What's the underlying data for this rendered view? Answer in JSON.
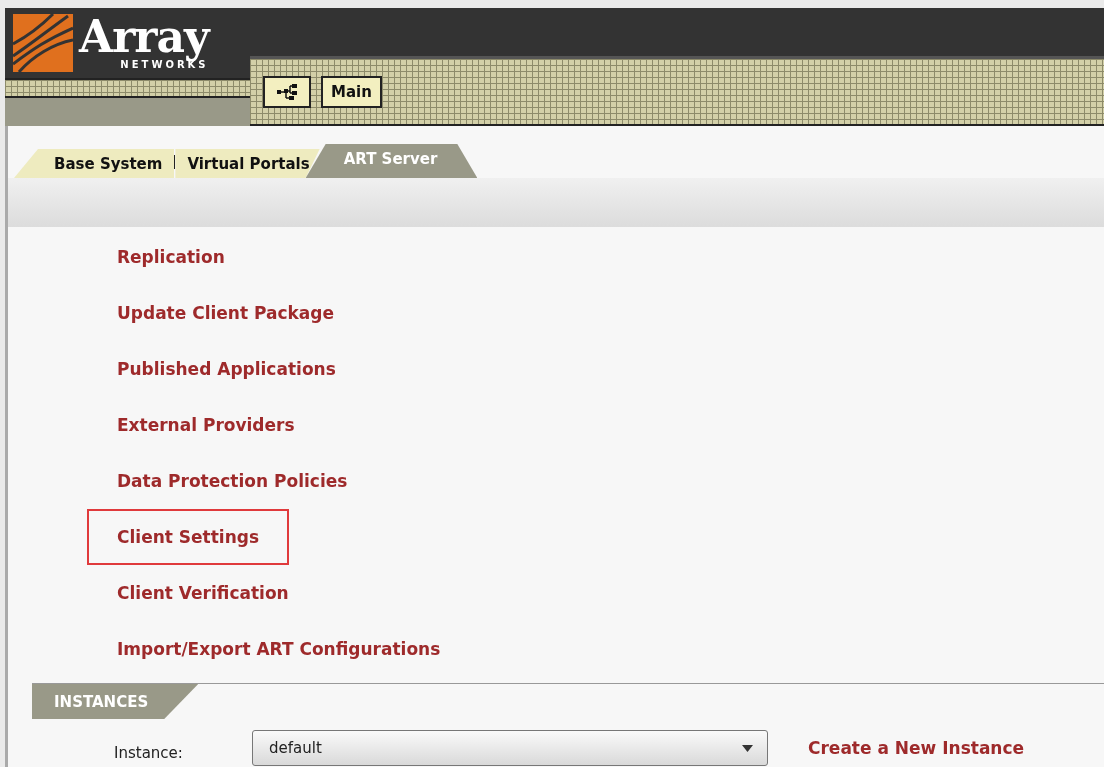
{
  "logo": {
    "name": "Array",
    "subtitle": "NETWORKS"
  },
  "header_buttons": [
    {
      "kind": "icon"
    },
    {
      "kind": "text",
      "label": "Main"
    }
  ],
  "tabs": [
    {
      "label": "Base System",
      "selected": false
    },
    {
      "label": "Virtual Portals",
      "selected": false
    },
    {
      "label": "ART Server",
      "selected": true
    }
  ],
  "menu_items": [
    {
      "label": "Replication",
      "highlighted": false
    },
    {
      "label": "Update Client Package",
      "highlighted": false
    },
    {
      "label": "Published Applications",
      "highlighted": false
    },
    {
      "label": "External Providers",
      "highlighted": false
    },
    {
      "label": "Data Protection Policies",
      "highlighted": false
    },
    {
      "label": "Client Settings",
      "highlighted": true
    },
    {
      "label": "Client Verification",
      "highlighted": false
    },
    {
      "label": "Import/Export ART Configurations",
      "highlighted": false
    }
  ],
  "instances": {
    "title": "INSTANCES",
    "label": "Instance:",
    "value": "default",
    "link": "Create a New Instance"
  }
}
